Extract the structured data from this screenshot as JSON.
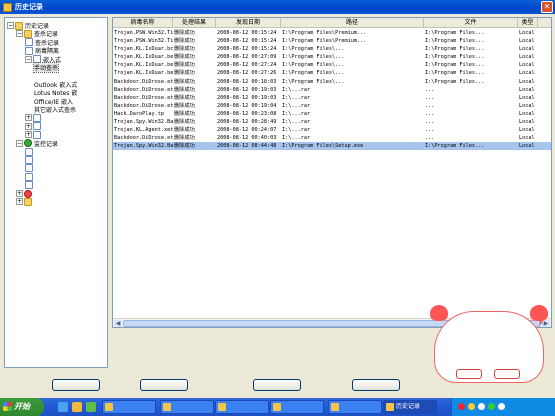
{
  "window": {
    "title": "历史记录"
  },
  "tree": [
    {
      "label": "历史记录",
      "toggle": "-",
      "icon": "folder",
      "indent": 0
    },
    {
      "label": "查杀记录",
      "toggle": "-",
      "icon": "folder",
      "indent": 1
    },
    {
      "label": "查杀记录",
      "toggle": "",
      "icon": "doc",
      "indent": 2
    },
    {
      "label": "病毒隔离",
      "toggle": "",
      "icon": "doc",
      "indent": 2
    },
    {
      "label": "嵌入式",
      "toggle": "-",
      "icon": "doc",
      "indent": 2
    },
    {
      "label": "手动查杀",
      "toggle": "",
      "icon": "",
      "indent": 3,
      "selected": true
    },
    {
      "label": "",
      "toggle": "",
      "icon": "",
      "indent": 3
    },
    {
      "label": "Outlook 嵌入式",
      "toggle": "",
      "icon": "",
      "indent": 3
    },
    {
      "label": "Lotus Notes 嵌",
      "toggle": "",
      "icon": "",
      "indent": 3
    },
    {
      "label": "Office/IE 嵌入",
      "toggle": "",
      "icon": "",
      "indent": 3
    },
    {
      "label": "其它嵌入式查杀",
      "toggle": "",
      "icon": "",
      "indent": 3
    },
    {
      "label": "",
      "toggle": "+",
      "icon": "doc",
      "indent": 2
    },
    {
      "label": "",
      "toggle": "+",
      "icon": "doc",
      "indent": 2
    },
    {
      "label": "",
      "toggle": "+",
      "icon": "doc",
      "indent": 2
    },
    {
      "label": "监控记录",
      "toggle": "-",
      "icon": "green",
      "indent": 1
    },
    {
      "label": "",
      "toggle": "",
      "icon": "doc",
      "indent": 2
    },
    {
      "label": "",
      "toggle": "",
      "icon": "doc",
      "indent": 2
    },
    {
      "label": "",
      "toggle": "",
      "icon": "doc",
      "indent": 2
    },
    {
      "label": "",
      "toggle": "",
      "icon": "doc",
      "indent": 2
    },
    {
      "label": "",
      "toggle": "",
      "icon": "doc",
      "indent": 2
    },
    {
      "label": "",
      "toggle": "+",
      "icon": "red",
      "indent": 1
    },
    {
      "label": "",
      "toggle": "+",
      "icon": "folder",
      "indent": 1
    }
  ],
  "list": {
    "columns": [
      "病毒名称",
      "处理结果",
      "发现日期",
      "路径",
      "文件",
      "类型"
    ],
    "rows": [
      {
        "name": "Trojan.PSW.Win32.Tibi..",
        "status": "删除成功",
        "date": "2008-08-12 00:15:24",
        "path": "I:\\Program Files\\Premium...",
        "file": "I:\\Program Files...",
        "type": "Local",
        "selected": false
      },
      {
        "name": "Trojan.PSW.Win32.Tibi..",
        "status": "删除成功",
        "date": "2008-08-12 00:15:24",
        "path": "I:\\Program Files\\Premium...",
        "file": "I:\\Program Files...",
        "type": "Local",
        "selected": false
      },
      {
        "name": "Trojan.KL.IsDuar.bcb",
        "status": "删除成功",
        "date": "2008-08-12 00:15:24",
        "path": "I:\\Program Files\\...",
        "file": "I:\\Program Files...",
        "type": "Local",
        "selected": false
      },
      {
        "name": "Trojan.KL.IsDuar.be",
        "status": "删除成功",
        "date": "2008-08-12 00:27:09",
        "path": "I:\\Program Files\\...",
        "file": "I:\\Program Files...",
        "type": "Local",
        "selected": false
      },
      {
        "name": "Trojan.KL.IsDuar.be",
        "status": "删除成功",
        "date": "2008-08-12 00:27:24",
        "path": "I:\\Program Files\\...",
        "file": "I:\\Program Files...",
        "type": "Local",
        "selected": false
      },
      {
        "name": "Trojan.KL.IsDuar.be",
        "status": "删除成功",
        "date": "2008-08-12 00:27:26",
        "path": "I:\\Program Files\\...",
        "file": "I:\\Program Files...",
        "type": "Local",
        "selected": false
      },
      {
        "name": "Backdoor.DiDrose.eta",
        "status": "删除成功",
        "date": "2008-08-12 00:18:03",
        "path": "I:\\Program Files\\...",
        "file": "I:\\Program Files...",
        "type": "Local",
        "selected": false
      },
      {
        "name": "Backdoor.DiDrose.eta",
        "status": "删除成功",
        "date": "2008-08-12 00:19:03",
        "path": "I:\\...rar",
        "file": "...",
        "type": "Local",
        "selected": false
      },
      {
        "name": "Backdoor.DiDrose.eta",
        "status": "删除成功",
        "date": "2008-08-12 00:19:03",
        "path": "I:\\...rar",
        "file": "...",
        "type": "Local",
        "selected": false
      },
      {
        "name": "Backdoor.DiDrose.eta",
        "status": "删除成功",
        "date": "2008-08-12 00:19:04",
        "path": "I:\\...rar",
        "file": "...",
        "type": "Local",
        "selected": false
      },
      {
        "name": "Hack.DaroPlay.tp",
        "status": "删除成功",
        "date": "2008-08-12 00:23:08",
        "path": "I:\\...rar",
        "file": "...",
        "type": "Local",
        "selected": false
      },
      {
        "name": "Trojan.Spy.Win32.Bank..",
        "status": "删除成功",
        "date": "2008-08-12 00:28:49",
        "path": "I:\\...rar",
        "file": "...",
        "type": "Local",
        "selected": false
      },
      {
        "name": "Trojan.KL.Agent.xet",
        "status": "删除成功",
        "date": "2008-08-12 00:24:07",
        "path": "I:\\...rar",
        "file": "...",
        "type": "Local",
        "selected": false
      },
      {
        "name": "Backdoor.DiDrose.eta",
        "status": "删除成功",
        "date": "2008-08-12 00:40:03",
        "path": "I:\\...rar",
        "file": "...",
        "type": "Local",
        "selected": false
      },
      {
        "name": "Trojan.Spy.Win32.Bank..",
        "status": "删除成功",
        "date": "2008-08-12 08:44:48",
        "path": "I:\\Program Files\\Setup.exe",
        "file": "I:\\Program Files...",
        "type": "Local",
        "selected": true
      }
    ]
  },
  "status_line": {
    "text": "",
    "link": ""
  },
  "buttons": {
    "clear": "",
    "find": "",
    "export": "",
    "close": ""
  },
  "balloon": {
    "message": "",
    "ok": "",
    "close": ""
  },
  "taskbar": {
    "start_label": "开始",
    "tasks": [
      {
        "label": "",
        "active": false
      },
      {
        "label": "",
        "active": false
      },
      {
        "label": "",
        "active": false
      },
      {
        "label": "",
        "active": false
      },
      {
        "label": "",
        "active": false
      },
      {
        "label": "历史记录",
        "active": true
      }
    ],
    "clock": ""
  }
}
